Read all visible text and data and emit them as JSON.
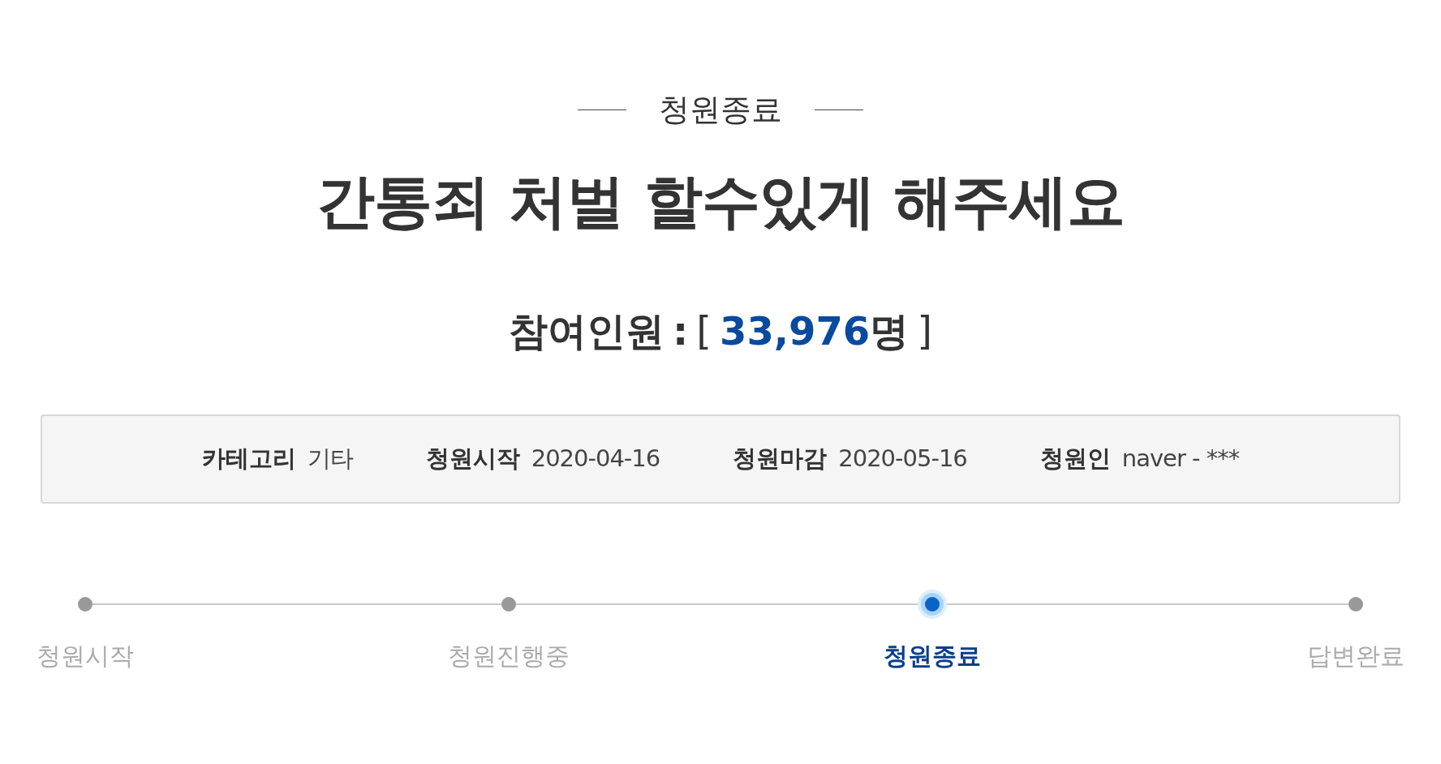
{
  "status_label": "청원종료",
  "title": "간통죄 처벌 할수있게 해주세요",
  "participants": {
    "label": "참여인원",
    "separator": ":",
    "open": "[",
    "count": "33,976",
    "unit": "명",
    "close": "]"
  },
  "info": [
    {
      "label": "카테고리",
      "value": "기타"
    },
    {
      "label": "청원시작",
      "value": "2020-04-16"
    },
    {
      "label": "청원마감",
      "value": "2020-05-16"
    },
    {
      "label": "청원인",
      "value": "naver - ***"
    }
  ],
  "steps": [
    {
      "label": "청원시작",
      "selected": false
    },
    {
      "label": "청원진행중",
      "selected": false
    },
    {
      "label": "청원종료",
      "selected": true
    },
    {
      "label": "답변완료",
      "selected": false
    }
  ]
}
